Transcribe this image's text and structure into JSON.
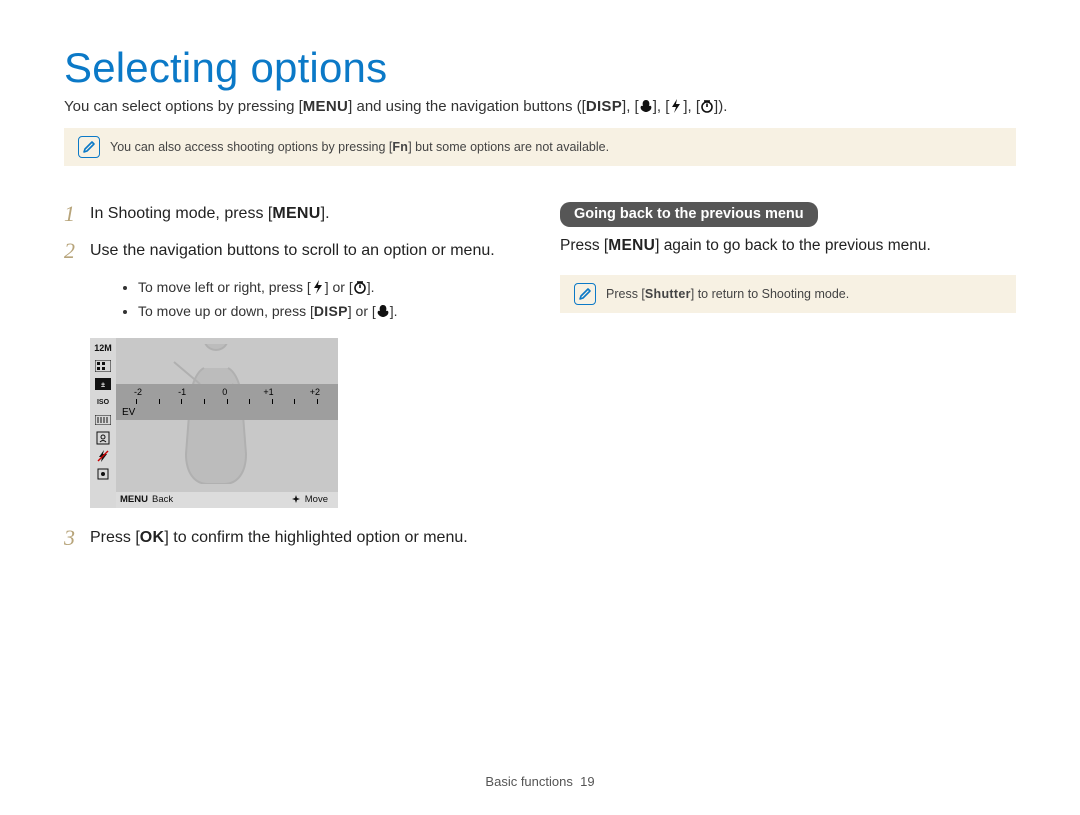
{
  "title": "Selecting options",
  "intro": {
    "pre": "You can select options by pressing [",
    "menu_btn": "MENU",
    "mid": "] and using the navigation buttons ([",
    "disp_btn": "DISP",
    "sep": "], [",
    "end": "])."
  },
  "note_top": {
    "pre": "You can also access shooting options by pressing [",
    "fn_btn": "Fn",
    "post": "] but some options are not available."
  },
  "steps": {
    "s1": {
      "num": "1",
      "pre": "In Shooting mode, press [",
      "btn": "MENU",
      "post": "]."
    },
    "s2": {
      "num": "2",
      "text": "Use the navigation buttons to scroll to an option or menu."
    },
    "bullets": {
      "b1": {
        "pre": "To move left or right, press [",
        "or": "] or [",
        "post": "]."
      },
      "b2": {
        "pre": "To move up or down, press [",
        "btn": "DISP",
        "or": "] or [",
        "post": "]."
      }
    },
    "s3": {
      "num": "3",
      "pre": "Press [",
      "btn": "OK",
      "post": "] to confirm the highlighted option or menu."
    }
  },
  "lcd": {
    "mp": "12M",
    "ev_marks": [
      "-2",
      "-1",
      "0",
      "+1",
      "+2"
    ],
    "ev_label": "EV",
    "footer_menu": "MENU",
    "footer_back": "Back",
    "footer_move": "Move"
  },
  "right": {
    "pill": "Going back to the previous menu",
    "text_pre": "Press [",
    "text_btn": "MENU",
    "text_post": "] again to go back to the previous menu.",
    "note_pre": "Press [",
    "note_btn": "Shutter",
    "note_post": "] to return to Shooting mode."
  },
  "footer": {
    "section": "Basic functions",
    "page": "19"
  }
}
